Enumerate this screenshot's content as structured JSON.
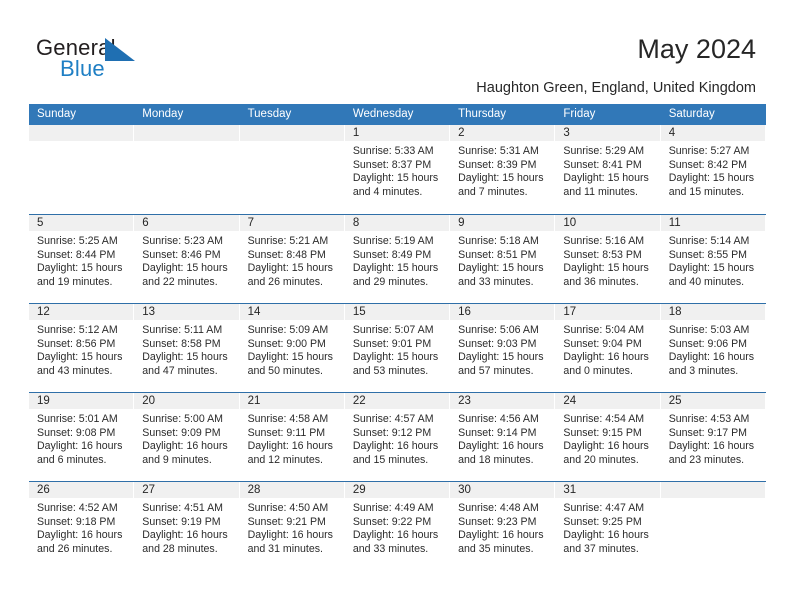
{
  "logo": {
    "word_one": "General",
    "word_two": "Blue",
    "triangle_color": "#1f6fb2",
    "text_color": "#231f20",
    "blue_text_color": "#1f7fc4"
  },
  "header": {
    "title": "May 2024",
    "subtitle": "Haughton Green, England, United Kingdom"
  },
  "colors": {
    "header_blue": "#3178b8",
    "row_divider": "#2f6fa8",
    "daynum_strip": "#f0f0f0",
    "text": "#262626"
  },
  "calendar": {
    "weekdays": [
      "Sunday",
      "Monday",
      "Tuesday",
      "Wednesday",
      "Thursday",
      "Friday",
      "Saturday"
    ],
    "weeks": [
      [
        {
          "day": "",
          "lines": []
        },
        {
          "day": "",
          "lines": []
        },
        {
          "day": "",
          "lines": []
        },
        {
          "day": "1",
          "lines": [
            "Sunrise: 5:33 AM",
            "Sunset: 8:37 PM",
            "Daylight: 15 hours",
            "and 4 minutes."
          ]
        },
        {
          "day": "2",
          "lines": [
            "Sunrise: 5:31 AM",
            "Sunset: 8:39 PM",
            "Daylight: 15 hours",
            "and 7 minutes."
          ]
        },
        {
          "day": "3",
          "lines": [
            "Sunrise: 5:29 AM",
            "Sunset: 8:41 PM",
            "Daylight: 15 hours",
            "and 11 minutes."
          ]
        },
        {
          "day": "4",
          "lines": [
            "Sunrise: 5:27 AM",
            "Sunset: 8:42 PM",
            "Daylight: 15 hours",
            "and 15 minutes."
          ]
        }
      ],
      [
        {
          "day": "5",
          "lines": [
            "Sunrise: 5:25 AM",
            "Sunset: 8:44 PM",
            "Daylight: 15 hours",
            "and 19 minutes."
          ]
        },
        {
          "day": "6",
          "lines": [
            "Sunrise: 5:23 AM",
            "Sunset: 8:46 PM",
            "Daylight: 15 hours",
            "and 22 minutes."
          ]
        },
        {
          "day": "7",
          "lines": [
            "Sunrise: 5:21 AM",
            "Sunset: 8:48 PM",
            "Daylight: 15 hours",
            "and 26 minutes."
          ]
        },
        {
          "day": "8",
          "lines": [
            "Sunrise: 5:19 AM",
            "Sunset: 8:49 PM",
            "Daylight: 15 hours",
            "and 29 minutes."
          ]
        },
        {
          "day": "9",
          "lines": [
            "Sunrise: 5:18 AM",
            "Sunset: 8:51 PM",
            "Daylight: 15 hours",
            "and 33 minutes."
          ]
        },
        {
          "day": "10",
          "lines": [
            "Sunrise: 5:16 AM",
            "Sunset: 8:53 PM",
            "Daylight: 15 hours",
            "and 36 minutes."
          ]
        },
        {
          "day": "11",
          "lines": [
            "Sunrise: 5:14 AM",
            "Sunset: 8:55 PM",
            "Daylight: 15 hours",
            "and 40 minutes."
          ]
        }
      ],
      [
        {
          "day": "12",
          "lines": [
            "Sunrise: 5:12 AM",
            "Sunset: 8:56 PM",
            "Daylight: 15 hours",
            "and 43 minutes."
          ]
        },
        {
          "day": "13",
          "lines": [
            "Sunrise: 5:11 AM",
            "Sunset: 8:58 PM",
            "Daylight: 15 hours",
            "and 47 minutes."
          ]
        },
        {
          "day": "14",
          "lines": [
            "Sunrise: 5:09 AM",
            "Sunset: 9:00 PM",
            "Daylight: 15 hours",
            "and 50 minutes."
          ]
        },
        {
          "day": "15",
          "lines": [
            "Sunrise: 5:07 AM",
            "Sunset: 9:01 PM",
            "Daylight: 15 hours",
            "and 53 minutes."
          ]
        },
        {
          "day": "16",
          "lines": [
            "Sunrise: 5:06 AM",
            "Sunset: 9:03 PM",
            "Daylight: 15 hours",
            "and 57 minutes."
          ]
        },
        {
          "day": "17",
          "lines": [
            "Sunrise: 5:04 AM",
            "Sunset: 9:04 PM",
            "Daylight: 16 hours",
            "and 0 minutes."
          ]
        },
        {
          "day": "18",
          "lines": [
            "Sunrise: 5:03 AM",
            "Sunset: 9:06 PM",
            "Daylight: 16 hours",
            "and 3 minutes."
          ]
        }
      ],
      [
        {
          "day": "19",
          "lines": [
            "Sunrise: 5:01 AM",
            "Sunset: 9:08 PM",
            "Daylight: 16 hours",
            "and 6 minutes."
          ]
        },
        {
          "day": "20",
          "lines": [
            "Sunrise: 5:00 AM",
            "Sunset: 9:09 PM",
            "Daylight: 16 hours",
            "and 9 minutes."
          ]
        },
        {
          "day": "21",
          "lines": [
            "Sunrise: 4:58 AM",
            "Sunset: 9:11 PM",
            "Daylight: 16 hours",
            "and 12 minutes."
          ]
        },
        {
          "day": "22",
          "lines": [
            "Sunrise: 4:57 AM",
            "Sunset: 9:12 PM",
            "Daylight: 16 hours",
            "and 15 minutes."
          ]
        },
        {
          "day": "23",
          "lines": [
            "Sunrise: 4:56 AM",
            "Sunset: 9:14 PM",
            "Daylight: 16 hours",
            "and 18 minutes."
          ]
        },
        {
          "day": "24",
          "lines": [
            "Sunrise: 4:54 AM",
            "Sunset: 9:15 PM",
            "Daylight: 16 hours",
            "and 20 minutes."
          ]
        },
        {
          "day": "25",
          "lines": [
            "Sunrise: 4:53 AM",
            "Sunset: 9:17 PM",
            "Daylight: 16 hours",
            "and 23 minutes."
          ]
        }
      ],
      [
        {
          "day": "26",
          "lines": [
            "Sunrise: 4:52 AM",
            "Sunset: 9:18 PM",
            "Daylight: 16 hours",
            "and 26 minutes."
          ]
        },
        {
          "day": "27",
          "lines": [
            "Sunrise: 4:51 AM",
            "Sunset: 9:19 PM",
            "Daylight: 16 hours",
            "and 28 minutes."
          ]
        },
        {
          "day": "28",
          "lines": [
            "Sunrise: 4:50 AM",
            "Sunset: 9:21 PM",
            "Daylight: 16 hours",
            "and 31 minutes."
          ]
        },
        {
          "day": "29",
          "lines": [
            "Sunrise: 4:49 AM",
            "Sunset: 9:22 PM",
            "Daylight: 16 hours",
            "and 33 minutes."
          ]
        },
        {
          "day": "30",
          "lines": [
            "Sunrise: 4:48 AM",
            "Sunset: 9:23 PM",
            "Daylight: 16 hours",
            "and 35 minutes."
          ]
        },
        {
          "day": "31",
          "lines": [
            "Sunrise: 4:47 AM",
            "Sunset: 9:25 PM",
            "Daylight: 16 hours",
            "and 37 minutes."
          ]
        },
        {
          "day": "",
          "lines": []
        }
      ]
    ]
  }
}
